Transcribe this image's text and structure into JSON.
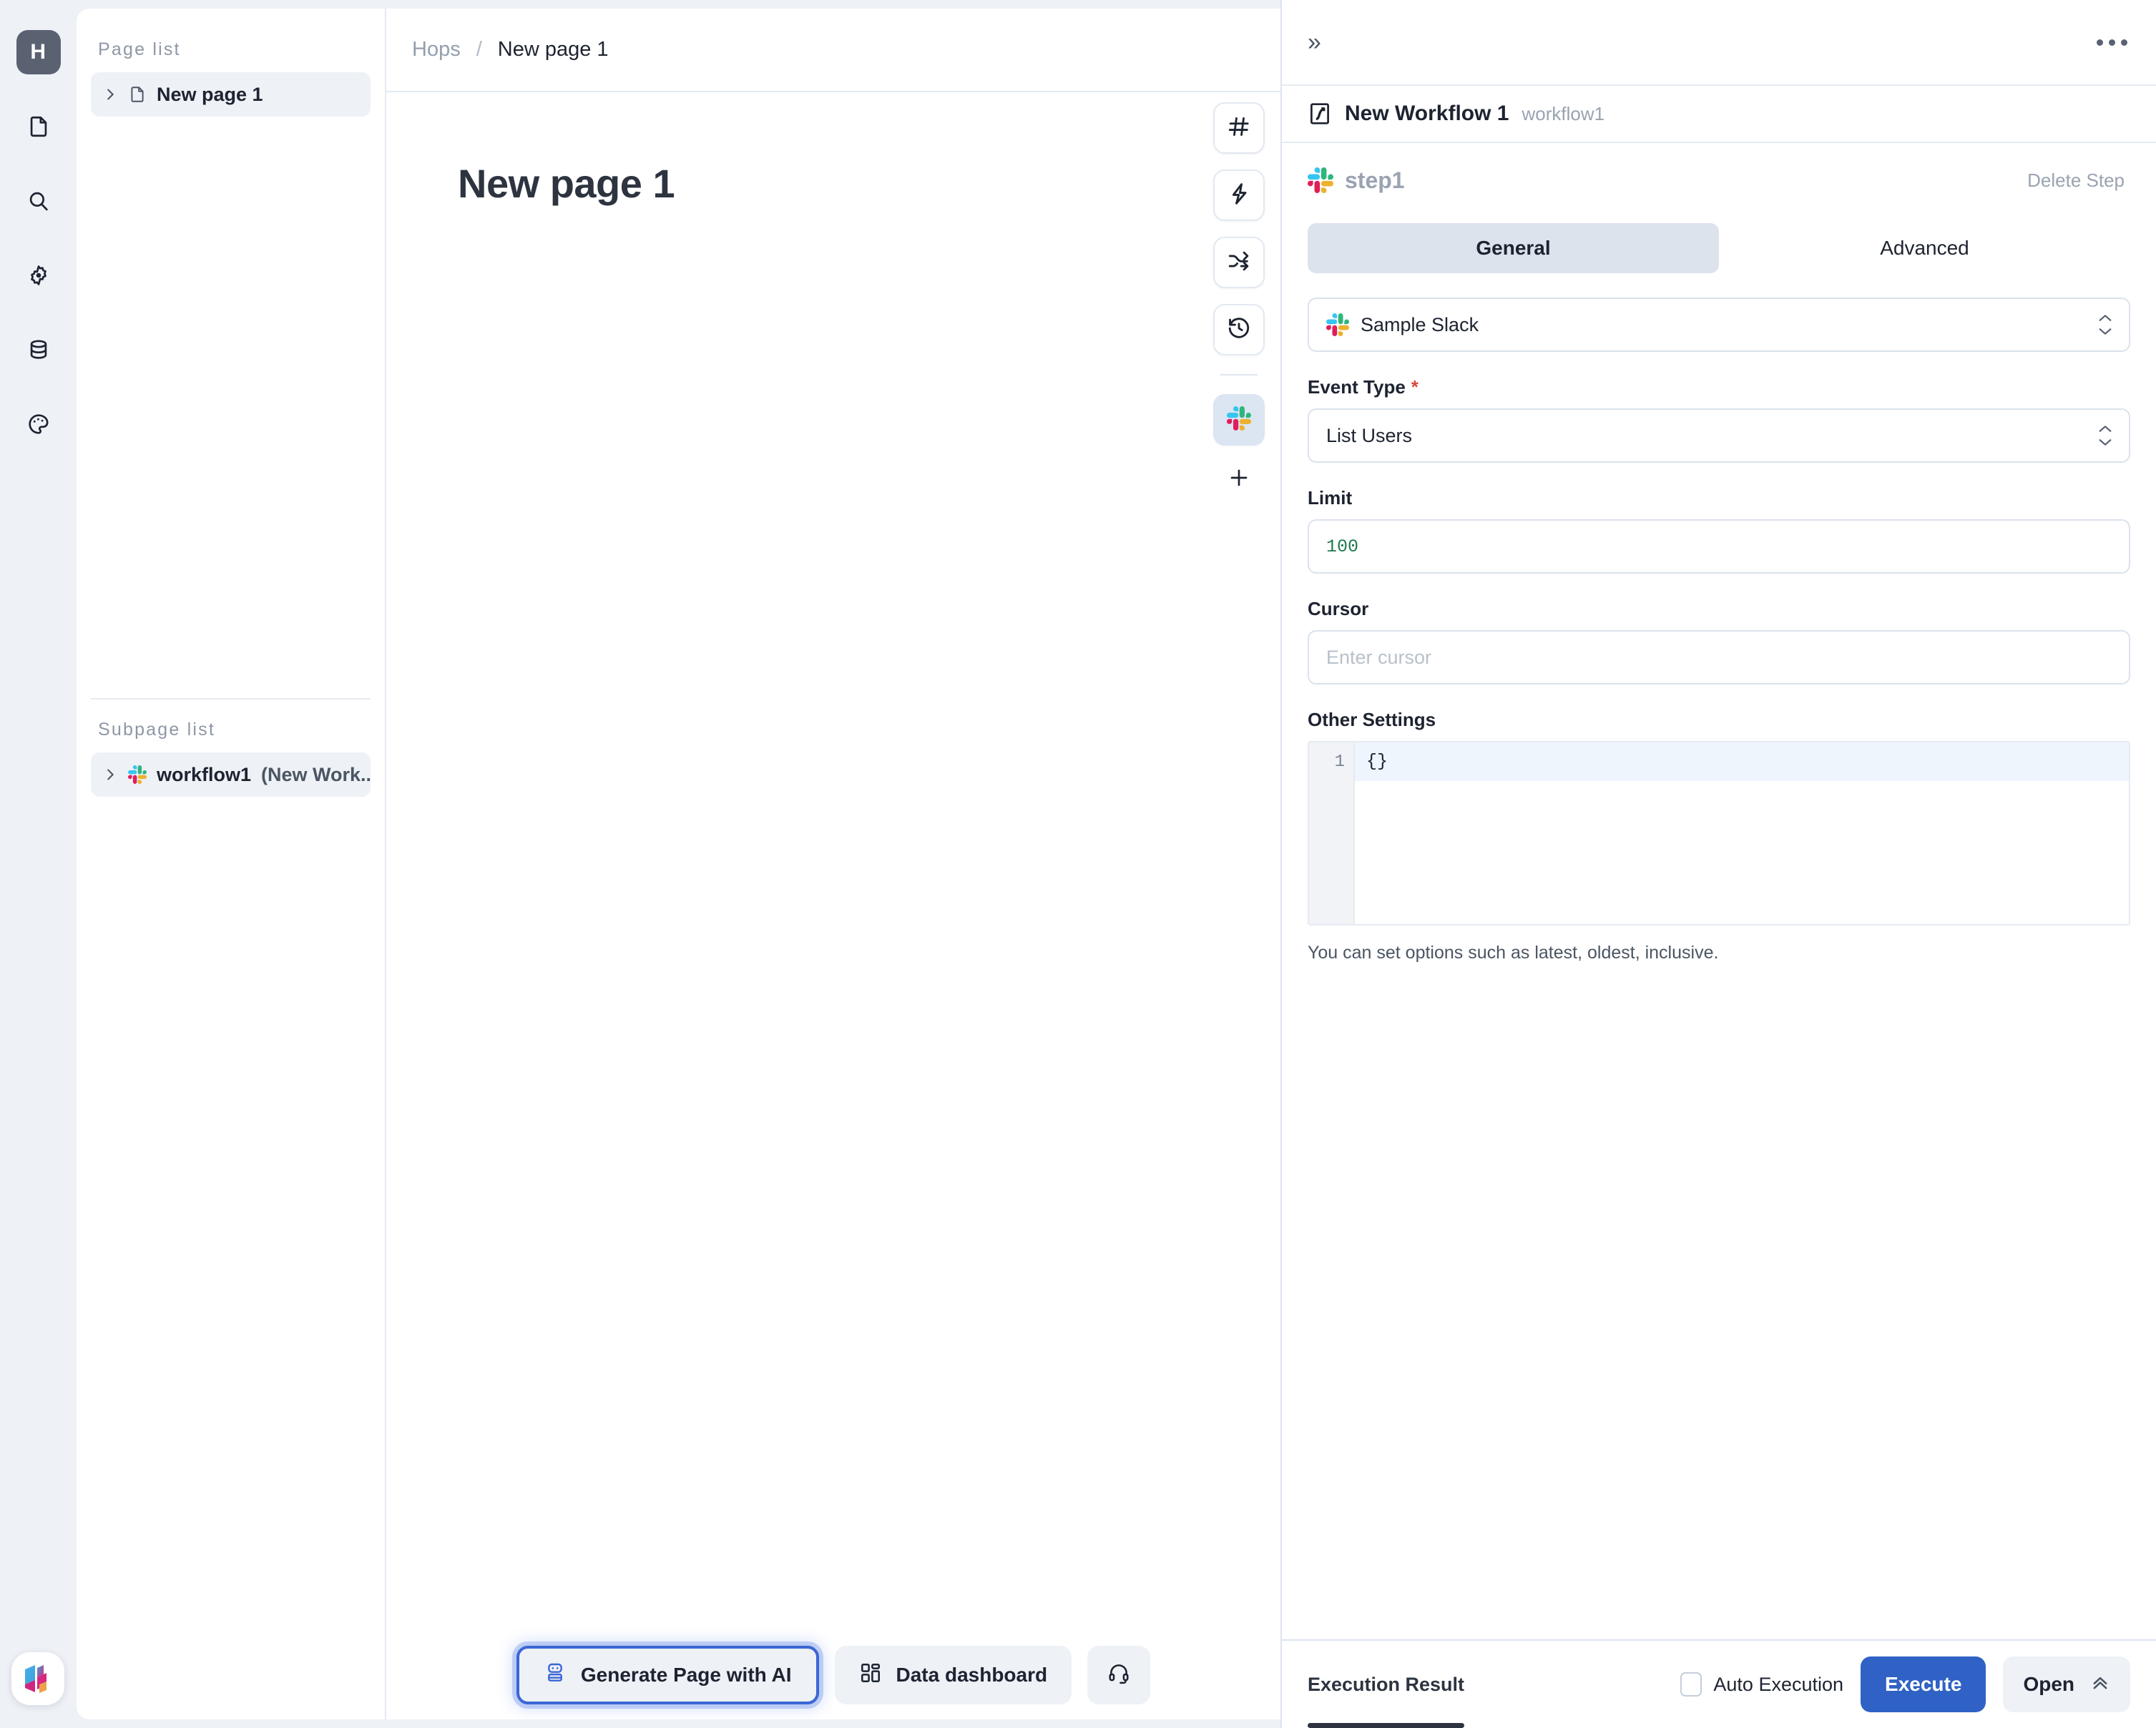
{
  "rail": {
    "logo_label": "H",
    "items": [
      {
        "name": "document-icon",
        "label": "Documents"
      },
      {
        "name": "search-icon",
        "label": "Search"
      },
      {
        "name": "gear-icon",
        "label": "Settings"
      },
      {
        "name": "database-icon",
        "label": "Data"
      },
      {
        "name": "palette-icon",
        "label": "Theme"
      }
    ],
    "bottom_logo_name": "hops-brand-logo"
  },
  "pagelist": {
    "section_label": "Page list",
    "items": [
      {
        "label": "New page 1"
      }
    ],
    "subpage_label": "Subpage list",
    "subpages": [
      {
        "label": "workflow1 ",
        "suffix": "(New Work..."
      }
    ]
  },
  "breadcrumb": {
    "root": "Hops",
    "separator": "/",
    "current": "New page 1"
  },
  "canvas": {
    "title": "New page 1",
    "toolbar": [
      {
        "name": "hash-icon",
        "label": "Heading block"
      },
      {
        "name": "lightning-icon",
        "label": "Action block"
      },
      {
        "name": "shuffle-icon",
        "label": "Branch block"
      },
      {
        "name": "history-icon",
        "label": "History"
      },
      {
        "name": "slack-icon",
        "label": "Slack step",
        "active": true
      }
    ],
    "add_label": "+"
  },
  "bottombar": {
    "buttons": [
      {
        "label": "Generate Page with AI",
        "icon": "robot-icon",
        "highlighted": true
      },
      {
        "label": "Data dashboard",
        "icon": "dashboard-icon",
        "highlighted": false
      },
      {
        "label": "",
        "icon": "headset-icon",
        "highlighted": false
      }
    ]
  },
  "rightpanel": {
    "expand_icon": "»",
    "more_icon": "ellipsis-icon",
    "workflow": {
      "icon": "workflow-icon",
      "name": "New Workflow 1",
      "slug": "workflow1"
    },
    "step": {
      "icon": "slack-icon",
      "name": "step1",
      "delete_label": "Delete Step"
    },
    "tabs": [
      {
        "label": "General",
        "active": true
      },
      {
        "label": "Advanced",
        "active": false
      }
    ],
    "connection": {
      "value": "Sample Slack",
      "icon": "slack-icon"
    },
    "fields": [
      {
        "key": "event_type",
        "label": "Event Type",
        "required": true,
        "type": "select",
        "value": "List Users"
      },
      {
        "key": "limit",
        "label": "Limit",
        "required": false,
        "type": "number",
        "value": "100"
      },
      {
        "key": "cursor",
        "label": "Cursor",
        "required": false,
        "type": "text",
        "value": "",
        "placeholder": "Enter cursor"
      }
    ],
    "other_settings": {
      "label": "Other Settings",
      "line_number": "1",
      "code": "{}",
      "hint": "You can set options such as latest, oldest, inclusive."
    },
    "footer": {
      "result_tab": "Execution Result",
      "auto_execution_label": "Auto Execution",
      "auto_execution_checked": false,
      "execute_label": "Execute",
      "open_label": "Open",
      "open_icon": "chevron-double-up-icon"
    }
  },
  "colors": {
    "accent": "#2f62c4",
    "highlight_outline": "#3b66d4",
    "panel_bg": "#ffffff",
    "app_bg": "#eef1f6",
    "muted_text": "#9aa3b1",
    "required_star": "#d94a3d",
    "code_value": "#1f7a4d"
  }
}
